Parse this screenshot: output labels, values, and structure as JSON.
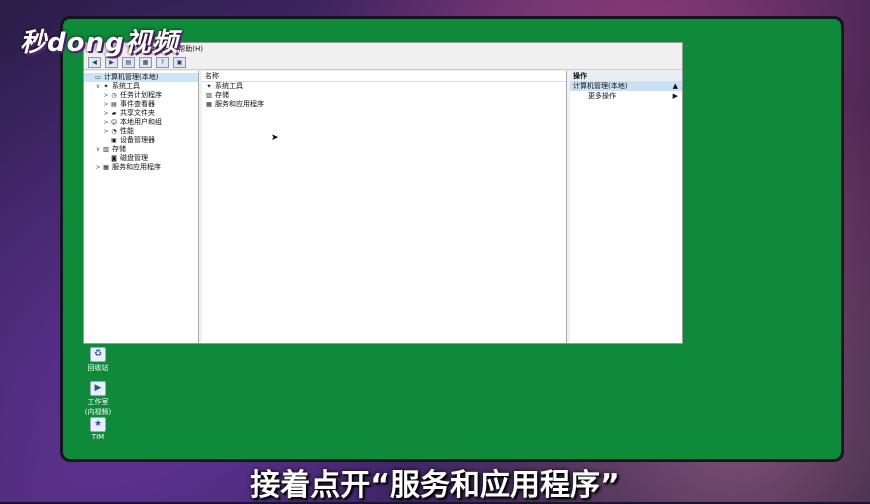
{
  "watermark": {
    "brand": "秒dong视频"
  },
  "caption": "接着点开“服务和应用程序”",
  "window": {
    "menu": [
      "查看(V)",
      "帮助(H)"
    ],
    "tree": [
      {
        "label": "计算机管理(本地)",
        "level": 0,
        "expander": "",
        "icon": "computer-icon",
        "selected": true
      },
      {
        "label": "系统工具",
        "level": 1,
        "expander": "∨",
        "icon": "tools-icon"
      },
      {
        "label": "任务计划程序",
        "level": 2,
        "expander": ">",
        "icon": "clock-icon"
      },
      {
        "label": "事件查看器",
        "level": 2,
        "expander": ">",
        "icon": "event-icon"
      },
      {
        "label": "共享文件夹",
        "level": 2,
        "expander": ">",
        "icon": "folder-icon"
      },
      {
        "label": "本地用户和组",
        "level": 2,
        "expander": ">",
        "icon": "users-icon"
      },
      {
        "label": "性能",
        "level": 2,
        "expander": ">",
        "icon": "performance-icon"
      },
      {
        "label": "设备管理器",
        "level": 2,
        "expander": "",
        "icon": "device-icon"
      },
      {
        "label": "存储",
        "level": 1,
        "expander": "∨",
        "icon": "storage-icon"
      },
      {
        "label": "磁盘管理",
        "level": 2,
        "expander": "",
        "icon": "disk-icon"
      },
      {
        "label": "服务和应用程序",
        "level": 1,
        "expander": ">",
        "icon": "services-icon"
      }
    ],
    "list_header": "名称",
    "list_items": [
      {
        "label": "系统工具",
        "icon": "tools-icon"
      },
      {
        "label": "存储",
        "icon": "storage-icon"
      },
      {
        "label": "服务和应用程序",
        "icon": "services-icon"
      }
    ],
    "actions": {
      "header": "操作",
      "title": "计算机管理(本地)",
      "title_arrow": "▲",
      "item": "更多操作",
      "item_arrow": "▶"
    }
  },
  "desktop_icons": [
    {
      "label": "回收站",
      "icon": "recycle-bin-icon"
    },
    {
      "label": "工作室(内视频)",
      "icon": "studio-icon"
    },
    {
      "label": "TIM",
      "icon": "tim-icon"
    }
  ],
  "colors": {
    "desktop": "#0e8a3a",
    "selection": "#cce4f7"
  }
}
